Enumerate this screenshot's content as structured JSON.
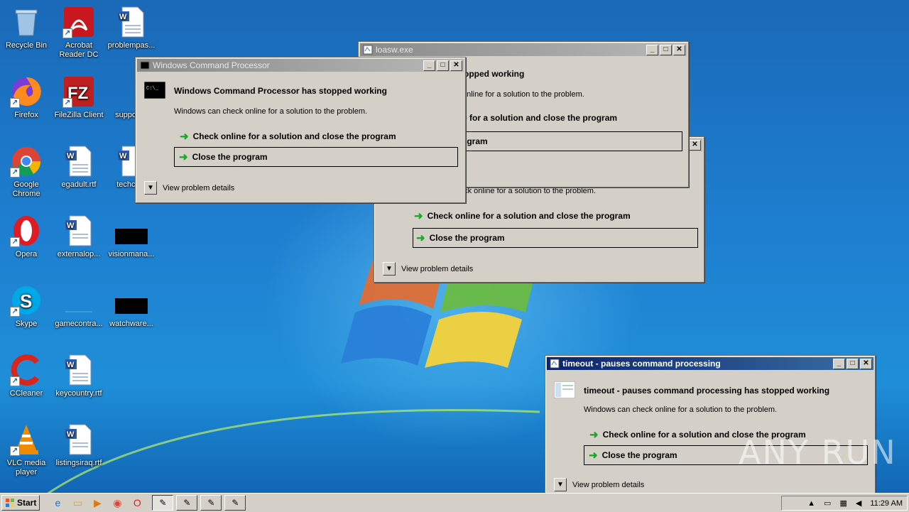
{
  "desktop": {
    "icons": [
      {
        "label": "Recycle Bin"
      },
      {
        "label": "Acrobat Reader DC"
      },
      {
        "label": "problempas..."
      },
      {
        "label": "Firefox"
      },
      {
        "label": "FileZilla Client"
      },
      {
        "label": "support..."
      },
      {
        "label": "Google Chrome"
      },
      {
        "label": "egadult.rtf"
      },
      {
        "label": "techch..."
      },
      {
        "label": "Opera"
      },
      {
        "label": "externalop..."
      },
      {
        "label": "visionmana..."
      },
      {
        "label": "Skype"
      },
      {
        "label": "gamecontra..."
      },
      {
        "label": "watchware..."
      },
      {
        "label": "CCleaner"
      },
      {
        "label": "keycountry.rtf"
      },
      {
        "label": "VLC media player"
      },
      {
        "label": "listingsiraq.rtf"
      }
    ]
  },
  "dialogs": {
    "cmd": {
      "title": "Windows Command Processor",
      "headline": "Windows Command Processor has stopped working",
      "subtext": "Windows can check online for a solution to the problem.",
      "opt1": "Check online for a solution and close the program",
      "opt2": "Close the program",
      "details": "View problem details"
    },
    "loasw": {
      "title": "loasw.exe",
      "headline_partial": "topped working",
      "subtext_partial": "online for a solution to the problem.",
      "opt1_partial": "e for a solution and close the program",
      "opt2_partial": "ogram"
    },
    "third": {
      "subtext_partial": "eck online for a solution to the problem.",
      "opt1": "Check online for a solution and close the program",
      "opt2": "Close the program",
      "details": "View problem details"
    },
    "timeout": {
      "title": "timeout - pauses command processing",
      "headline": "timeout - pauses command processing has stopped working",
      "subtext": "Windows can check online for a solution to the problem.",
      "opt1": "Check online for a solution and close the program",
      "opt2": "Close the program",
      "details": "View problem details"
    }
  },
  "taskbar": {
    "start_label": "Start",
    "clock": "11:29 AM"
  },
  "watermark": "ANY RUN",
  "colors": {
    "titlebar_active": "#0a246a",
    "titlebar_inactive": "#8a8a8a",
    "dialog_face": "#d4d0c8",
    "green_arrow": "#22a52e"
  }
}
